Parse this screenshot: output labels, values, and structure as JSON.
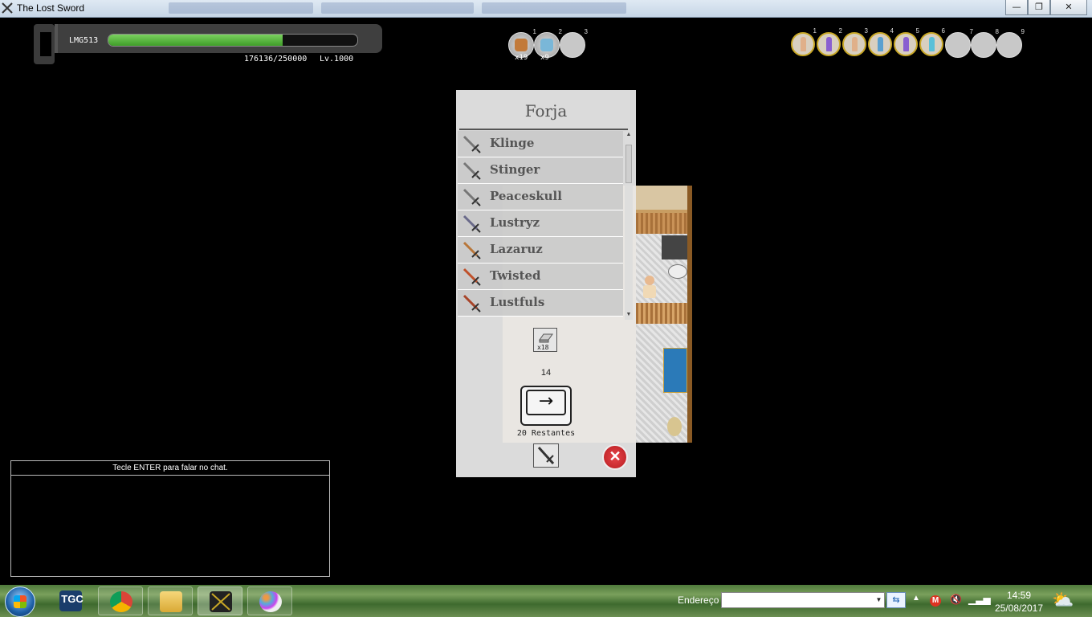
{
  "window": {
    "title": "The Lost Sword",
    "buttons": {
      "minimize": "—",
      "restore": "❐",
      "close": "✕"
    }
  },
  "hud": {
    "player_name": "LMG513",
    "hp_fraction": 0.7,
    "xp_text": "176136/250000",
    "level_text": "Lv.1000"
  },
  "item_slots": [
    {
      "slot": "1",
      "qty": "x19",
      "icon": "bread-icon",
      "color": "#c27a3a"
    },
    {
      "slot": "2",
      "qty": "x9",
      "icon": "potion-icon",
      "color": "#7ab7d8"
    },
    {
      "slot": "3",
      "qty": "",
      "icon": "",
      "color": ""
    }
  ],
  "party_slots": [
    {
      "slot": "1",
      "color": "#e0b08a"
    },
    {
      "slot": "2",
      "color": "#8a5fd0"
    },
    {
      "slot": "3",
      "color": "#e0b08a"
    },
    {
      "slot": "4",
      "color": "#5aa0d0"
    },
    {
      "slot": "5",
      "color": "#8a5fd0"
    },
    {
      "slot": "6",
      "color": "#5ac0d8"
    },
    {
      "slot": "7",
      "color": ""
    },
    {
      "slot": "8",
      "color": ""
    },
    {
      "slot": "9",
      "color": ""
    }
  ],
  "forge": {
    "title": "Forja",
    "recipes": [
      {
        "name": "Klinge",
        "color": "#777"
      },
      {
        "name": "Stinger",
        "color": "#777"
      },
      {
        "name": "Peaceskull",
        "color": "#777"
      },
      {
        "name": "Lustryz",
        "color": "#6a6a8a"
      },
      {
        "name": "Lazaruz",
        "color": "#b8763a"
      },
      {
        "name": "Twisted",
        "color": "#c0502a"
      },
      {
        "name": "Lustfuls",
        "color": "#a8452a"
      }
    ],
    "material_qty": "x18",
    "material_count": "14",
    "craft_arrow": "→",
    "remaining_text": "20 Restantes",
    "close_symbol": "✕"
  },
  "chat": {
    "hint": "Tecle ENTER para falar no chat."
  },
  "taskbar": {
    "apps": [
      {
        "name": "tgc",
        "label": "TGC"
      },
      {
        "name": "chrome",
        "label": ""
      },
      {
        "name": "explorer",
        "label": ""
      },
      {
        "name": "lost-sword",
        "label": ""
      },
      {
        "name": "paint",
        "label": ""
      }
    ],
    "address_label": "Endereço",
    "address_value": "",
    "clock_time": "14:59",
    "clock_date": "25/08/2017"
  }
}
